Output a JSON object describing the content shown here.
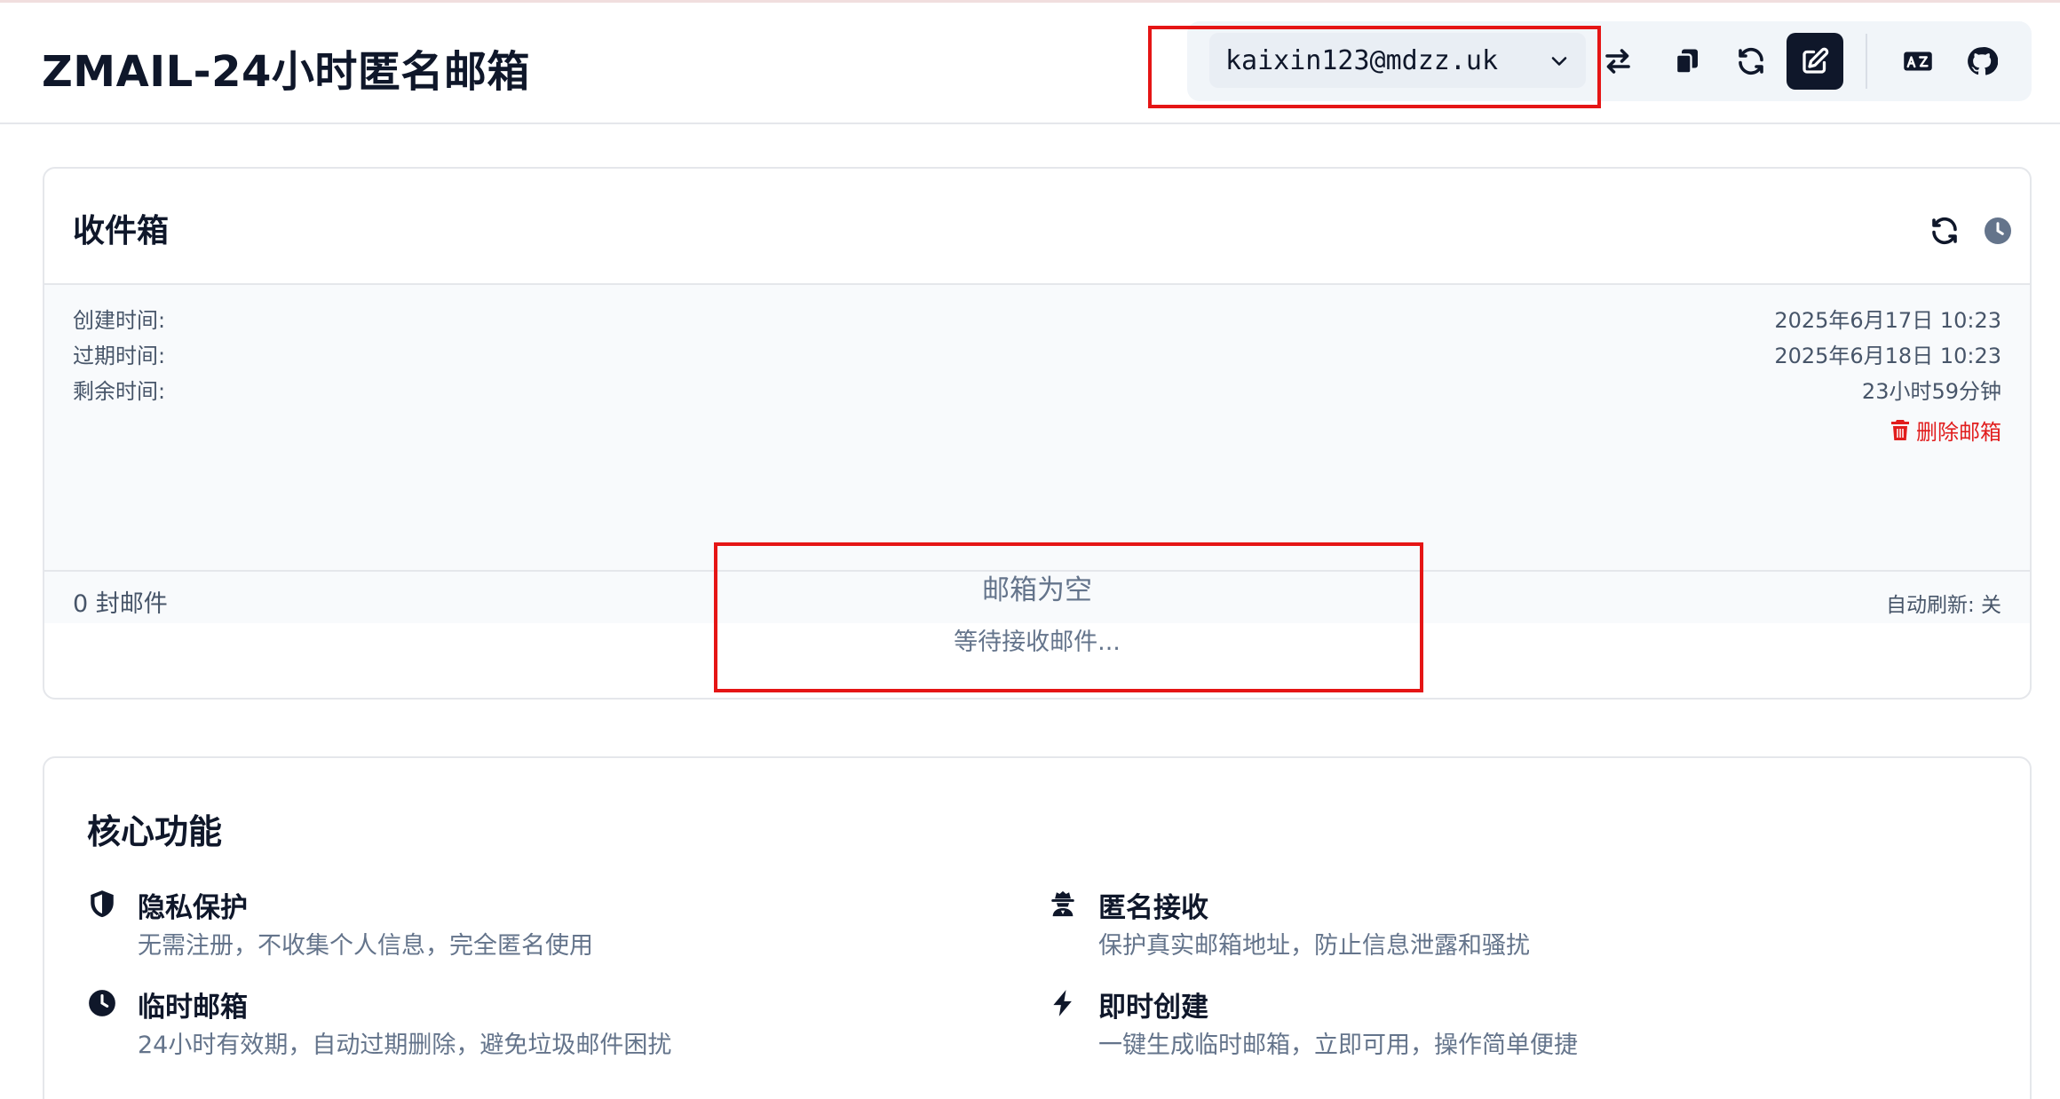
{
  "header": {
    "title": "ZMAIL-24小时匿名邮箱",
    "email": "kaixin123@mdzz.uk",
    "toolbar_icons": [
      "swap-icon",
      "copy-icon",
      "refresh-icon",
      "edit-icon",
      "translate-icon",
      "github-icon"
    ]
  },
  "inbox": {
    "title": "收件箱",
    "created_label": "创建时间:",
    "created_value": "2025年6月17日 10:23",
    "expires_label": "过期时间:",
    "expires_value": "2025年6月18日 10:23",
    "remaining_label": "剩余时间:",
    "remaining_value": "23小时59分钟",
    "delete_label": "删除邮箱",
    "count_text": "0 封邮件",
    "auto_refresh": "自动刷新: 关",
    "empty_title": "邮箱为空",
    "empty_subtitle": "等待接收邮件..."
  },
  "features": {
    "title": "核心功能",
    "items": [
      {
        "icon": "shield-icon",
        "title": "隐私保护",
        "desc": "无需注册，不收集个人信息，完全匿名使用"
      },
      {
        "icon": "spy-icon",
        "title": "匿名接收",
        "desc": "保护真实邮箱地址，防止信息泄露和骚扰"
      },
      {
        "icon": "clock-icon",
        "title": "临时邮箱",
        "desc": "24小时有效期，自动过期删除，避免垃圾邮件困扰"
      },
      {
        "icon": "bolt-icon",
        "title": "即时创建",
        "desc": "一键生成临时邮箱，立即可用，操作简单便捷"
      }
    ]
  },
  "colors": {
    "highlight": "#e51515",
    "danger": "#e11d1d",
    "dark": "#0f172a",
    "muted": "#64748b"
  }
}
